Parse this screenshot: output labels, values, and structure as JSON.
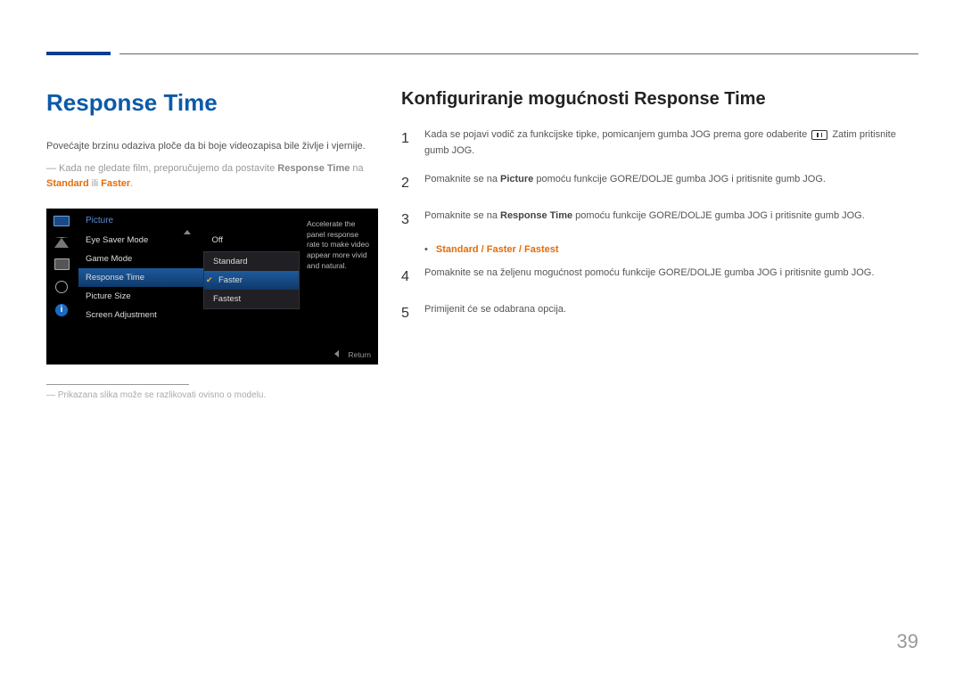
{
  "page": {
    "number": "39"
  },
  "left": {
    "heading": "Response Time",
    "intro": "Povećajte brzinu odaziva ploče da bi boje videozapisa bile življe i vjernije.",
    "note_pre": "― Kada ne gledate film, preporučujemo da postavite ",
    "note_bold": "Response Time",
    "note_mid": " na ",
    "note_orange1": "Standard",
    "note_or": " ili ",
    "note_orange2": "Faster",
    "note_end": ".",
    "footnote": "Prikazana slika može se razlikovati ovisno o modelu."
  },
  "osd": {
    "title": "Picture",
    "items": [
      {
        "label": "Eye Saver Mode",
        "value": "Off"
      },
      {
        "label": "Game Mode",
        "value": ""
      },
      {
        "label": "Response Time",
        "value": ""
      },
      {
        "label": "Picture Size",
        "value": ""
      },
      {
        "label": "Screen Adjustment",
        "value": ""
      }
    ],
    "submenu": [
      "Standard",
      "Faster",
      "Fastest"
    ],
    "help": "Accelerate the panel response rate to make video appear more vivid and natural.",
    "return": "Return",
    "info_letter": "i"
  },
  "right": {
    "heading": "Konfiguriranje mogućnosti Response Time",
    "steps": {
      "s1_a": "Kada se pojavi vodič za funkcijske tipke, pomicanjem gumba JOG prema gore odaberite ",
      "s1_b": " Zatim pritisnite gumb JOG.",
      "s2_a": "Pomaknite se na ",
      "s2_bold": "Picture",
      "s2_b": " pomoću funkcije GORE/DOLJE gumba JOG i pritisnite gumb JOG.",
      "s3_a": "Pomaknite se na ",
      "s3_bold": "Response Time",
      "s3_b": " pomoću funkcije GORE/DOLJE gumba JOG i pritisnite gumb JOG.",
      "options": {
        "a": "Standard",
        "sep": " / ",
        "b": "Faster",
        "c": "Fastest"
      },
      "s4": "Pomaknite se na željenu mogućnost pomoću funkcije GORE/DOLJE gumba JOG i pritisnite gumb JOG.",
      "s5": "Primijenit će se odabrana opcija."
    },
    "nums": {
      "n1": "1",
      "n2": "2",
      "n3": "3",
      "n4": "4",
      "n5": "5"
    }
  }
}
